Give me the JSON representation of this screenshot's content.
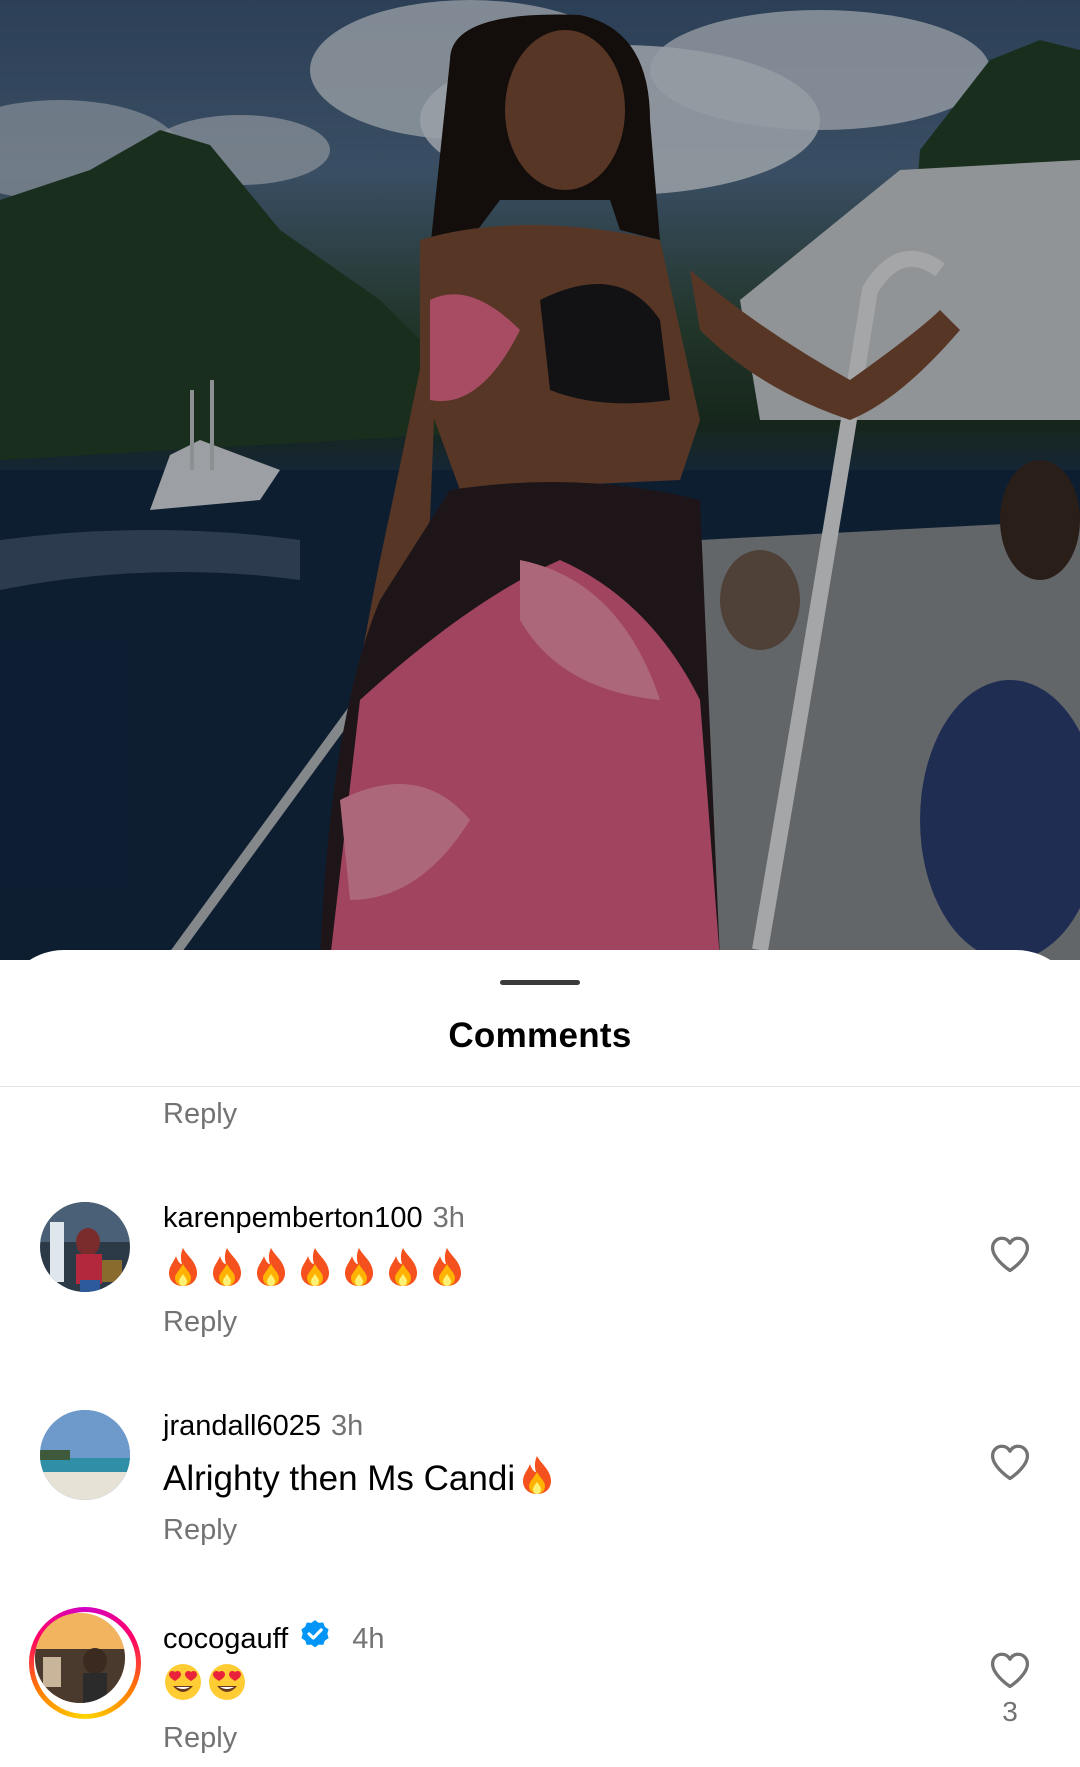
{
  "sheet": {
    "title": "Comments"
  },
  "previous_reply": "Reply",
  "comments": [
    {
      "username": "karenpemberton100",
      "time": "3h",
      "text": "",
      "emoji": "fire",
      "emoji_count": 7,
      "reply_label": "Reply",
      "verified": false,
      "has_story": false,
      "like_count": ""
    },
    {
      "username": "jrandall6025",
      "time": "3h",
      "text": "Alrighty then Ms Candi",
      "trailing_emoji": "fire",
      "reply_label": "Reply",
      "verified": false,
      "has_story": false,
      "like_count": ""
    },
    {
      "username": "cocogauff",
      "time": "4h",
      "text": "",
      "emoji": "heart-eyes",
      "emoji_count": 2,
      "reply_label": "Reply",
      "verified": true,
      "has_story": true,
      "like_count": "3"
    }
  ],
  "icons": {
    "like": "heart-outline-icon",
    "verified": "verified-badge-icon",
    "fire": "fire-emoji",
    "heart_eyes": "heart-eyes-emoji"
  },
  "colors": {
    "secondary_text": "#737373",
    "verified_blue": "#0095f6",
    "story_ring": [
      "#d300c5",
      "#ff0069",
      "#ff7a00",
      "#ffd600"
    ]
  }
}
